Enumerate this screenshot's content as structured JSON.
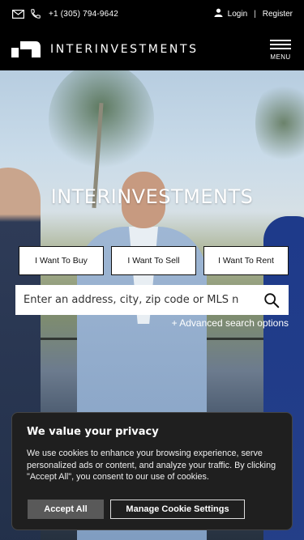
{
  "topbar": {
    "phone": "+1 (305) 794-9642",
    "login_label": "Login",
    "separator": "|",
    "register_label": "Register"
  },
  "header": {
    "brand": "INTERINVESTMENTS",
    "menu_label": "MENU"
  },
  "hero": {
    "title": "INTERINVESTMENTS",
    "tabs": [
      {
        "label": "I Want To Buy"
      },
      {
        "label": "I Want To Sell"
      },
      {
        "label": "I Want To Rent"
      }
    ],
    "search": {
      "placeholder": "Enter an address, city, zip code or MLS n"
    },
    "advanced_search_label": "+ Advanced search options"
  },
  "cookie_banner": {
    "title": "We value your privacy",
    "body": "We use cookies to enhance your browsing experience, serve personalized ads or content, and analyze your traffic. By clicking \"Accept All\", you consent to our use of cookies.",
    "accept_label": "Accept All",
    "settings_label": "Manage Cookie Settings"
  },
  "colors": {
    "background": "#000000",
    "cookie_bg": "#1f1f1f",
    "accept_bg": "#595959"
  },
  "icons": [
    "mail-icon",
    "phone-icon",
    "user-icon",
    "logo-mark",
    "hamburger-icon",
    "search-icon"
  ]
}
